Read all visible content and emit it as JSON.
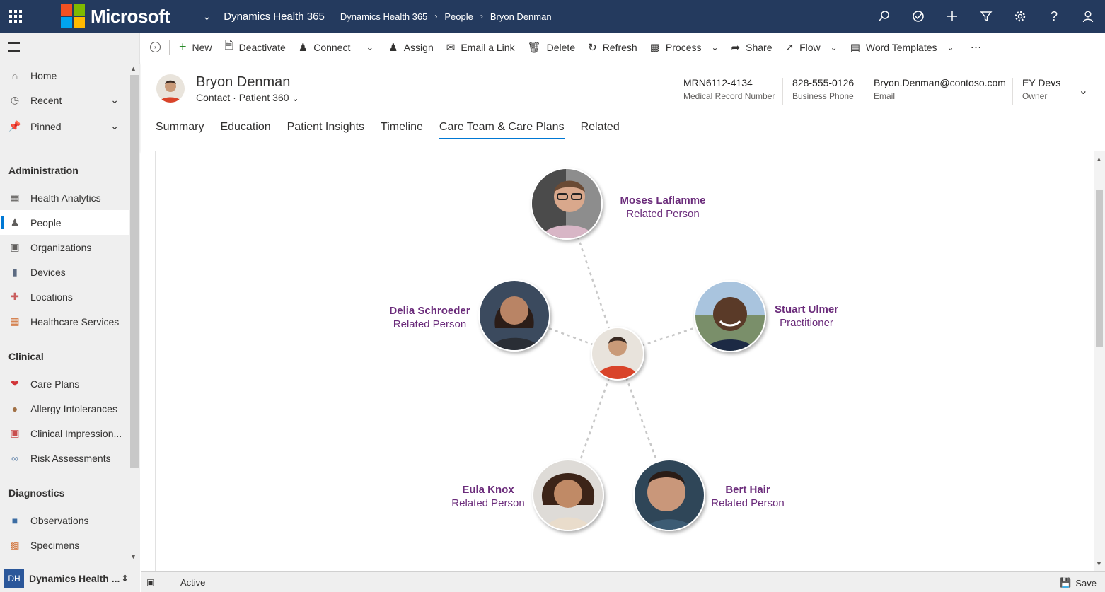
{
  "topbar": {
    "brand": "Microsoft",
    "app_title": "Dynamics Health 365",
    "breadcrumb": [
      "Dynamics Health 365",
      "People",
      "Bryon Denman"
    ],
    "icons": [
      "search-icon",
      "tasks-icon",
      "plus-icon",
      "filter-icon",
      "gear-icon",
      "help-icon",
      "user-icon"
    ]
  },
  "sidebar": {
    "top_items": [
      {
        "label": "Home",
        "icon": "home-icon"
      },
      {
        "label": "Recent",
        "icon": "clock-icon"
      },
      {
        "label": "Pinned",
        "icon": "pin-icon"
      }
    ],
    "groups": [
      {
        "title": "Administration",
        "items": [
          "Health Analytics",
          "People",
          "Organizations",
          "Devices",
          "Locations",
          "Healthcare Services"
        ]
      },
      {
        "title": "Clinical",
        "items": [
          "Care Plans",
          "Allergy Intolerances",
          "Clinical Impression...",
          "Risk Assessments"
        ]
      },
      {
        "title": "Diagnostics",
        "items": [
          "Observations",
          "Specimens"
        ]
      }
    ],
    "active_item": "People",
    "area": {
      "badge": "DH",
      "name": "Dynamics Health ..."
    }
  },
  "commands": [
    "New",
    "Deactivate",
    "Connect",
    "Assign",
    "Email a Link",
    "Delete",
    "Refresh",
    "Process",
    "Share",
    "Flow",
    "Word Templates"
  ],
  "record": {
    "name": "Bryon Denman",
    "entity": "Contact",
    "form": "Patient 360",
    "mrn": "MRN6112-4134",
    "mrn_label": "Medical Record Number",
    "phone": "828-555-0126",
    "phone_label": "Business Phone",
    "email": "Bryon.Denman@contoso.com",
    "email_label": "Email",
    "owner": "EY Devs",
    "owner_label": "Owner"
  },
  "tabs": [
    "Summary",
    "Education",
    "Patient Insights",
    "Timeline",
    "Care Team & Care Plans",
    "Related"
  ],
  "active_tab": "Care Team & Care Plans",
  "care_team": [
    {
      "name": "Moses Laflamme",
      "role": "Related Person"
    },
    {
      "name": "Delia Schroeder",
      "role": "Related Person"
    },
    {
      "name": "Stuart Ulmer",
      "role": "Practitioner"
    },
    {
      "name": "Eula Knox",
      "role": "Related Person"
    },
    {
      "name": "Bert Hair",
      "role": "Related Person"
    }
  ],
  "status": {
    "state": "Active",
    "save_label": "Save"
  },
  "colors": {
    "topbar": "#243a5e",
    "accent": "#0078d4",
    "person_text": "#6b2c7b"
  }
}
